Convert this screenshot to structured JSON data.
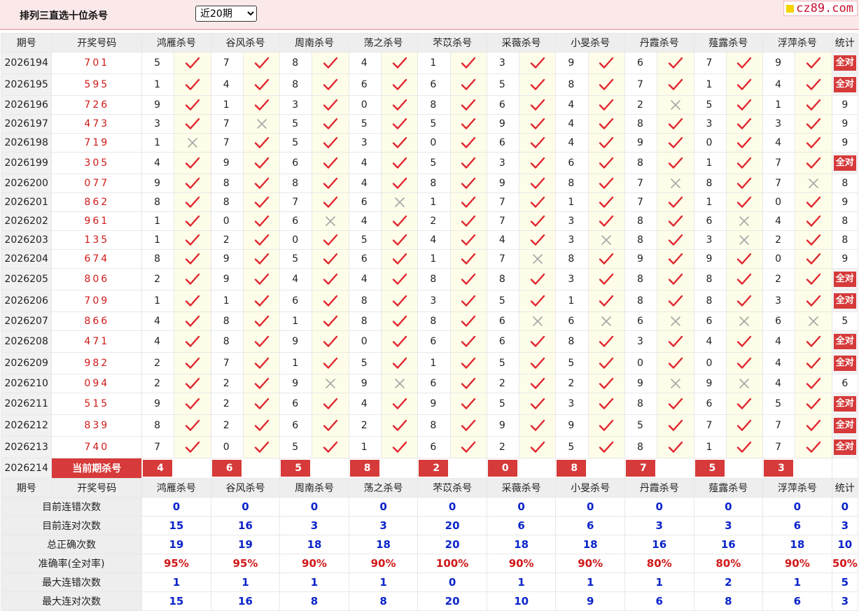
{
  "header": {
    "title": "排列三直选十位杀号",
    "period_select": {
      "selected": "近20期",
      "options": [
        "近20期"
      ]
    },
    "logo_text": "cz89.com"
  },
  "icons": {
    "right": "check-icon",
    "wrong": "cross-icon"
  },
  "colors": {
    "check": "#e0262e",
    "cross": "#a6a6a6",
    "accent_red": "#d63a3a",
    "stat_blue": "#0b24c9",
    "mark_cell_bg": "#fefde9"
  },
  "columns": {
    "issue": "期号",
    "draw": "开奖号码",
    "experts": [
      "鸿雁杀号",
      "谷风杀号",
      "周南杀号",
      "荡之杀号",
      "芣苡杀号",
      "采薇杀号",
      "小旻杀号",
      "丹霞杀号",
      "薤露杀号",
      "浮萍杀号"
    ],
    "stat": "统计"
  },
  "rows": [
    {
      "issue": "2026194",
      "draw": "701",
      "kills": [
        [
          5,
          true
        ],
        [
          7,
          true
        ],
        [
          8,
          true
        ],
        [
          4,
          true
        ],
        [
          1,
          true
        ],
        [
          3,
          true
        ],
        [
          9,
          true
        ],
        [
          6,
          true
        ],
        [
          7,
          true
        ],
        [
          9,
          true
        ]
      ],
      "stat": "全对"
    },
    {
      "issue": "2026195",
      "draw": "595",
      "kills": [
        [
          1,
          true
        ],
        [
          4,
          true
        ],
        [
          8,
          true
        ],
        [
          6,
          true
        ],
        [
          6,
          true
        ],
        [
          5,
          true
        ],
        [
          8,
          true
        ],
        [
          7,
          true
        ],
        [
          1,
          true
        ],
        [
          4,
          true
        ]
      ],
      "stat": "全对"
    },
    {
      "issue": "2026196",
      "draw": "726",
      "kills": [
        [
          9,
          true
        ],
        [
          1,
          true
        ],
        [
          3,
          true
        ],
        [
          0,
          true
        ],
        [
          8,
          true
        ],
        [
          6,
          true
        ],
        [
          4,
          true
        ],
        [
          2,
          false
        ],
        [
          5,
          true
        ],
        [
          1,
          true
        ]
      ],
      "stat": "9"
    },
    {
      "issue": "2026197",
      "draw": "473",
      "kills": [
        [
          3,
          true
        ],
        [
          7,
          false
        ],
        [
          5,
          true
        ],
        [
          5,
          true
        ],
        [
          5,
          true
        ],
        [
          9,
          true
        ],
        [
          4,
          true
        ],
        [
          8,
          true
        ],
        [
          3,
          true
        ],
        [
          3,
          true
        ]
      ],
      "stat": "9"
    },
    {
      "issue": "2026198",
      "draw": "719",
      "kills": [
        [
          1,
          false
        ],
        [
          7,
          true
        ],
        [
          5,
          true
        ],
        [
          3,
          true
        ],
        [
          0,
          true
        ],
        [
          6,
          true
        ],
        [
          4,
          true
        ],
        [
          9,
          true
        ],
        [
          0,
          true
        ],
        [
          4,
          true
        ]
      ],
      "stat": "9"
    },
    {
      "issue": "2026199",
      "draw": "305",
      "kills": [
        [
          4,
          true
        ],
        [
          9,
          true
        ],
        [
          6,
          true
        ],
        [
          4,
          true
        ],
        [
          5,
          true
        ],
        [
          3,
          true
        ],
        [
          6,
          true
        ],
        [
          8,
          true
        ],
        [
          1,
          true
        ],
        [
          7,
          true
        ]
      ],
      "stat": "全对"
    },
    {
      "issue": "2026200",
      "draw": "077",
      "kills": [
        [
          9,
          true
        ],
        [
          8,
          true
        ],
        [
          8,
          true
        ],
        [
          4,
          true
        ],
        [
          8,
          true
        ],
        [
          9,
          true
        ],
        [
          8,
          true
        ],
        [
          7,
          false
        ],
        [
          8,
          true
        ],
        [
          7,
          false
        ]
      ],
      "stat": "8"
    },
    {
      "issue": "2026201",
      "draw": "862",
      "kills": [
        [
          8,
          true
        ],
        [
          8,
          true
        ],
        [
          7,
          true
        ],
        [
          6,
          false
        ],
        [
          1,
          true
        ],
        [
          7,
          true
        ],
        [
          1,
          true
        ],
        [
          7,
          true
        ],
        [
          1,
          true
        ],
        [
          0,
          true
        ]
      ],
      "stat": "9"
    },
    {
      "issue": "2026202",
      "draw": "961",
      "kills": [
        [
          1,
          true
        ],
        [
          0,
          true
        ],
        [
          6,
          false
        ],
        [
          4,
          true
        ],
        [
          2,
          true
        ],
        [
          7,
          true
        ],
        [
          3,
          true
        ],
        [
          8,
          true
        ],
        [
          6,
          false
        ],
        [
          4,
          true
        ]
      ],
      "stat": "8"
    },
    {
      "issue": "2026203",
      "draw": "135",
      "kills": [
        [
          1,
          true
        ],
        [
          2,
          true
        ],
        [
          0,
          true
        ],
        [
          5,
          true
        ],
        [
          4,
          true
        ],
        [
          4,
          true
        ],
        [
          3,
          false
        ],
        [
          8,
          true
        ],
        [
          3,
          false
        ],
        [
          2,
          true
        ]
      ],
      "stat": "8"
    },
    {
      "issue": "2026204",
      "draw": "674",
      "kills": [
        [
          8,
          true
        ],
        [
          9,
          true
        ],
        [
          5,
          true
        ],
        [
          6,
          true
        ],
        [
          1,
          true
        ],
        [
          7,
          false
        ],
        [
          8,
          true
        ],
        [
          9,
          true
        ],
        [
          9,
          true
        ],
        [
          0,
          true
        ]
      ],
      "stat": "9"
    },
    {
      "issue": "2026205",
      "draw": "806",
      "kills": [
        [
          2,
          true
        ],
        [
          9,
          true
        ],
        [
          4,
          true
        ],
        [
          4,
          true
        ],
        [
          8,
          true
        ],
        [
          8,
          true
        ],
        [
          3,
          true
        ],
        [
          8,
          true
        ],
        [
          8,
          true
        ],
        [
          2,
          true
        ]
      ],
      "stat": "全对"
    },
    {
      "issue": "2026206",
      "draw": "709",
      "kills": [
        [
          1,
          true
        ],
        [
          1,
          true
        ],
        [
          6,
          true
        ],
        [
          8,
          true
        ],
        [
          3,
          true
        ],
        [
          5,
          true
        ],
        [
          1,
          true
        ],
        [
          8,
          true
        ],
        [
          8,
          true
        ],
        [
          3,
          true
        ]
      ],
      "stat": "全对"
    },
    {
      "issue": "2026207",
      "draw": "866",
      "kills": [
        [
          4,
          true
        ],
        [
          8,
          true
        ],
        [
          1,
          true
        ],
        [
          8,
          true
        ],
        [
          8,
          true
        ],
        [
          6,
          false
        ],
        [
          6,
          false
        ],
        [
          6,
          false
        ],
        [
          6,
          false
        ],
        [
          6,
          false
        ]
      ],
      "stat": "5"
    },
    {
      "issue": "2026208",
      "draw": "471",
      "kills": [
        [
          4,
          true
        ],
        [
          8,
          true
        ],
        [
          9,
          true
        ],
        [
          0,
          true
        ],
        [
          6,
          true
        ],
        [
          6,
          true
        ],
        [
          8,
          true
        ],
        [
          3,
          true
        ],
        [
          4,
          true
        ],
        [
          4,
          true
        ]
      ],
      "stat": "全对"
    },
    {
      "issue": "2026209",
      "draw": "982",
      "kills": [
        [
          2,
          true
        ],
        [
          7,
          true
        ],
        [
          1,
          true
        ],
        [
          5,
          true
        ],
        [
          1,
          true
        ],
        [
          5,
          true
        ],
        [
          5,
          true
        ],
        [
          0,
          true
        ],
        [
          0,
          true
        ],
        [
          4,
          true
        ]
      ],
      "stat": "全对"
    },
    {
      "issue": "2026210",
      "draw": "094",
      "kills": [
        [
          2,
          true
        ],
        [
          2,
          true
        ],
        [
          9,
          false
        ],
        [
          9,
          false
        ],
        [
          6,
          true
        ],
        [
          2,
          true
        ],
        [
          2,
          true
        ],
        [
          9,
          false
        ],
        [
          9,
          false
        ],
        [
          4,
          true
        ]
      ],
      "stat": "6"
    },
    {
      "issue": "2026211",
      "draw": "515",
      "kills": [
        [
          9,
          true
        ],
        [
          2,
          true
        ],
        [
          6,
          true
        ],
        [
          4,
          true
        ],
        [
          9,
          true
        ],
        [
          5,
          true
        ],
        [
          3,
          true
        ],
        [
          8,
          true
        ],
        [
          6,
          true
        ],
        [
          5,
          true
        ]
      ],
      "stat": "全对"
    },
    {
      "issue": "2026212",
      "draw": "839",
      "kills": [
        [
          8,
          true
        ],
        [
          2,
          true
        ],
        [
          6,
          true
        ],
        [
          2,
          true
        ],
        [
          8,
          true
        ],
        [
          9,
          true
        ],
        [
          9,
          true
        ],
        [
          5,
          true
        ],
        [
          7,
          true
        ],
        [
          7,
          true
        ]
      ],
      "stat": "全对"
    },
    {
      "issue": "2026213",
      "draw": "740",
      "kills": [
        [
          7,
          true
        ],
        [
          0,
          true
        ],
        [
          5,
          true
        ],
        [
          1,
          true
        ],
        [
          6,
          true
        ],
        [
          2,
          true
        ],
        [
          5,
          true
        ],
        [
          8,
          true
        ],
        [
          1,
          true
        ],
        [
          7,
          true
        ]
      ],
      "stat": "全对"
    }
  ],
  "current": {
    "issue": "2026214",
    "label": "当前期杀号",
    "kills": [
      "4",
      "6",
      "5",
      "8",
      "2",
      "0",
      "8",
      "7",
      "5",
      "3"
    ]
  },
  "stats": [
    {
      "label": "目前连错次数",
      "values": [
        "0",
        "0",
        "0",
        "0",
        "0",
        "0",
        "0",
        "0",
        "0",
        "0"
      ],
      "total": "0",
      "red": false
    },
    {
      "label": "目前连对次数",
      "values": [
        "15",
        "16",
        "3",
        "3",
        "20",
        "6",
        "6",
        "3",
        "3",
        "6"
      ],
      "total": "3",
      "red": false
    },
    {
      "label": "总正确次数",
      "values": [
        "19",
        "19",
        "18",
        "18",
        "20",
        "18",
        "18",
        "16",
        "16",
        "18"
      ],
      "total": "10",
      "red": false
    },
    {
      "label": "准确率(全对率)",
      "values": [
        "95%",
        "95%",
        "90%",
        "90%",
        "100%",
        "90%",
        "90%",
        "80%",
        "80%",
        "90%"
      ],
      "total": "50%",
      "red": true
    },
    {
      "label": "最大连错次数",
      "values": [
        "1",
        "1",
        "1",
        "1",
        "0",
        "1",
        "1",
        "1",
        "2",
        "1"
      ],
      "total": "5",
      "red": false
    },
    {
      "label": "最大连对次数",
      "values": [
        "15",
        "16",
        "8",
        "8",
        "20",
        "10",
        "9",
        "6",
        "8",
        "6"
      ],
      "total": "3",
      "red": false
    }
  ]
}
